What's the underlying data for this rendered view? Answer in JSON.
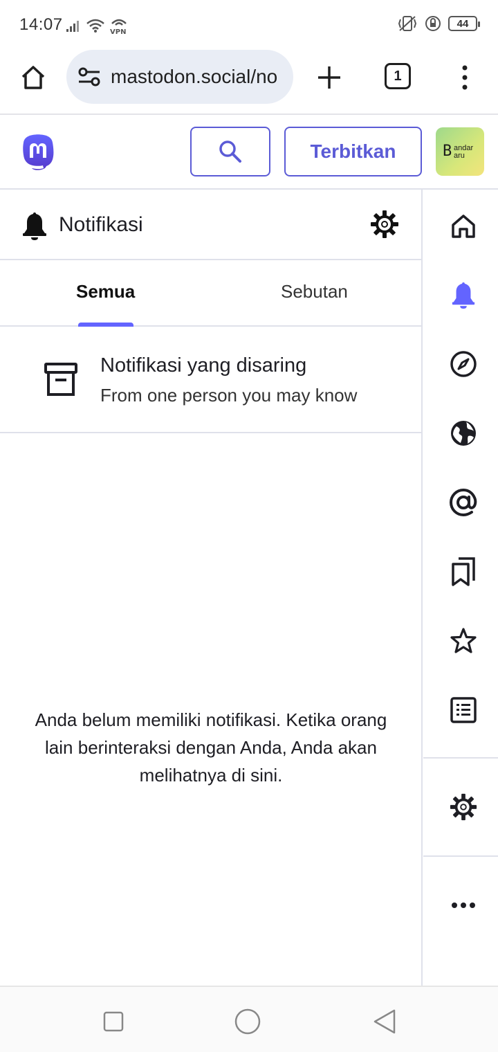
{
  "status_bar": {
    "time": "14:07",
    "battery_level": "44",
    "icons": [
      "signal-icon",
      "wifi-icon",
      "vpn-icon",
      "vibrate-icon",
      "lock-rotation-icon",
      "battery-icon"
    ]
  },
  "browser": {
    "url": "mastodon.social/no",
    "tab_count": "1"
  },
  "header": {
    "publish_label": "Terbitkan",
    "avatar_initials": {
      "big": "B",
      "line1": "andar",
      "line2": "aru"
    }
  },
  "column": {
    "title": "Notifikasi"
  },
  "tabs": [
    {
      "label": "Semua",
      "active": true
    },
    {
      "label": "Sebutan",
      "active": false
    }
  ],
  "filtered": {
    "title": "Notifikasi yang disaring",
    "subtitle": "From one person you may know"
  },
  "empty_message": "Anda belum memiliki notifikasi. Ketika orang lain berinteraksi dengan Anda, Anda akan melihatnya di sini.",
  "rail": {
    "items": [
      "home-icon",
      "bell-icon",
      "compass-icon",
      "globe-icon",
      "at-icon",
      "bookmarks-icon",
      "star-icon",
      "list-icon",
      "gear-icon",
      "more-icon"
    ],
    "active": "bell-icon"
  },
  "colors": {
    "accent": "#6364ff",
    "button_border": "#5b5bd6",
    "text": "#1e1e24",
    "divider": "#dfe1ea",
    "url_bg": "#e9edf5"
  }
}
